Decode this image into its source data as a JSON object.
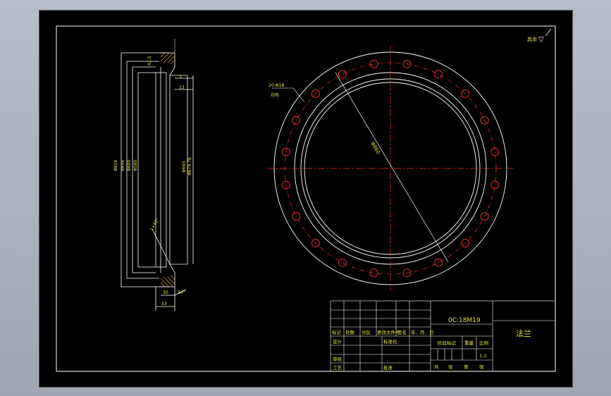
{
  "drawing": {
    "roughness_label": "其余",
    "roughness_mark": "▽",
    "part_name": "法兰",
    "drawing_number": "0C:18M19",
    "scale": "1:2",
    "hole_callout": "20-Φ18",
    "hole_callout_2": "均布",
    "dim_diagonal": "Φ860",
    "dims_left": [
      "Φ816",
      "Φ656",
      "Φ600",
      "Φ580"
    ],
    "dims_right": [
      "Φ660",
      "Φ674.78"
    ],
    "dim_fillet": "R1.5",
    "dim_3": "3",
    "dim_13": "13",
    "dim_30a": "30",
    "dim_30deg": "30°",
    "dim_33": "33",
    "dim_bevel": "1×45°"
  },
  "title_block": {
    "row_labels": [
      "标记",
      "处数",
      "分区",
      "更改文件号",
      "签名",
      "年、月、日"
    ],
    "design": "设计",
    "standardize": "标准化",
    "audit": "审核",
    "process": "工艺",
    "approve": "批准",
    "stage_mark": "阶段标记",
    "weight": "重量",
    "scale_label": "比例",
    "sheets": "共",
    "sheet_of": "张",
    "sheet_no": "第",
    "sheet_no2": "张"
  }
}
